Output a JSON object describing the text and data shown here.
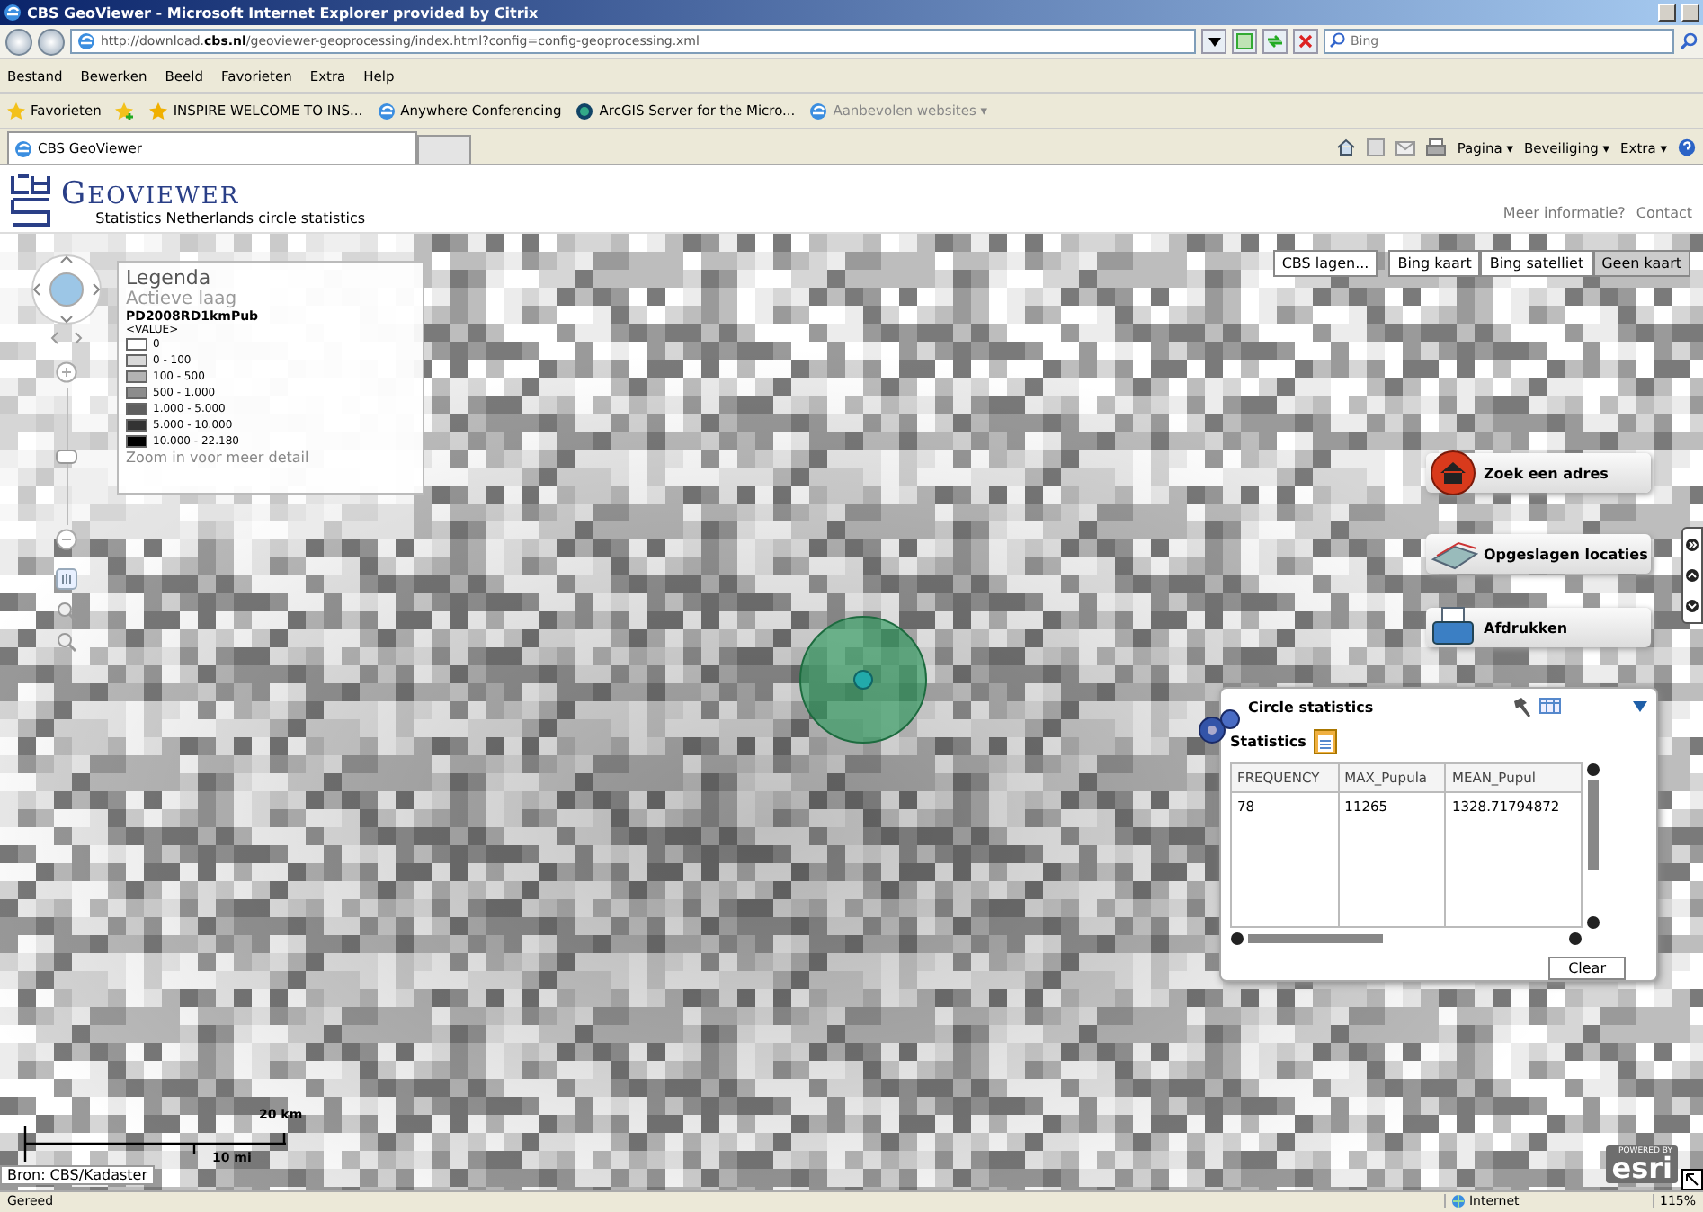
{
  "window": {
    "title": "CBS GeoViewer - Microsoft Internet Explorer provided by Citrix"
  },
  "address_bar": {
    "url": "http://download.**cbs.nl**/geoviewer-geoprocessing/index.html?config=config-geoprocessing.xml",
    "search_placeholder": "Bing"
  },
  "menu": [
    "Bestand",
    "Bewerken",
    "Beeld",
    "Favorieten",
    "Extra",
    "Help"
  ],
  "favorites_bar": {
    "label": "Favorieten",
    "links": [
      {
        "label": "INSPIRE WELCOME TO INS...",
        "dimmed": false
      },
      {
        "label": "Anywhere Conferencing",
        "dimmed": false
      },
      {
        "label": "ArcGIS Server for the Micro...",
        "dimmed": false
      },
      {
        "label": "Aanbevolen websites ▾",
        "dimmed": true
      }
    ]
  },
  "tabs": [
    {
      "label": "CBS GeoViewer",
      "selected": true
    }
  ],
  "command_bar": [
    "Pagina ▾",
    "Beveiliging ▾",
    "Extra ▾"
  ],
  "header": {
    "app_name": "GEOVIEWER",
    "subtitle": "Statistics Netherlands circle statistics",
    "links": [
      "Meer informatie?",
      "Contact"
    ]
  },
  "map": {
    "layers_button": "CBS lagen...",
    "basemaps": [
      {
        "label": "Bing kaart",
        "selected": false
      },
      {
        "label": "Bing satelliet",
        "selected": false
      },
      {
        "label": "Geen kaart",
        "selected": true
      }
    ],
    "legend": {
      "title": "Legenda",
      "subtitle": "Actieve laag",
      "layer": "PD2008RD1kmPub",
      "field": "<VALUE>",
      "items": [
        {
          "label": "0",
          "color": "#ffffff"
        },
        {
          "label": "0 - 100",
          "color": "#d9d9d9"
        },
        {
          "label": "100 - 500",
          "color": "#b3b3b3"
        },
        {
          "label": "500 - 1.000",
          "color": "#8c8c8c"
        },
        {
          "label": "1.000 - 5.000",
          "color": "#5e5e5e"
        },
        {
          "label": "5.000 - 10.000",
          "color": "#333333"
        },
        {
          "label": "10.000 - 22.180",
          "color": "#000000"
        }
      ],
      "note": "Zoom in voor meer detail"
    },
    "widgets": [
      {
        "kind": "house",
        "label": "Zoek een adres"
      },
      {
        "kind": "disks",
        "label": "Opgeslagen locaties"
      },
      {
        "kind": "printer",
        "label": "Afdrukken"
      }
    ],
    "zoom_slider": {
      "level": 0.5
    },
    "panel": {
      "title": "Circle statistics",
      "section": "Statistics",
      "columns": [
        "FREQUENCY",
        "MAX_Pupula",
        "MEAN_Pupul"
      ],
      "rows": [
        [
          "78",
          "11265",
          "1328.71794872"
        ]
      ],
      "clear_button": "Clear"
    },
    "scale": {
      "km": "20 km",
      "mi": "10 mi"
    },
    "attribution": "Bron: CBS/Kadaster",
    "logo": {
      "tagline": "POWERED BY",
      "name": "esri"
    }
  },
  "status_bar": {
    "text": "Gereed",
    "zone": "Internet",
    "zoom": "115%"
  }
}
